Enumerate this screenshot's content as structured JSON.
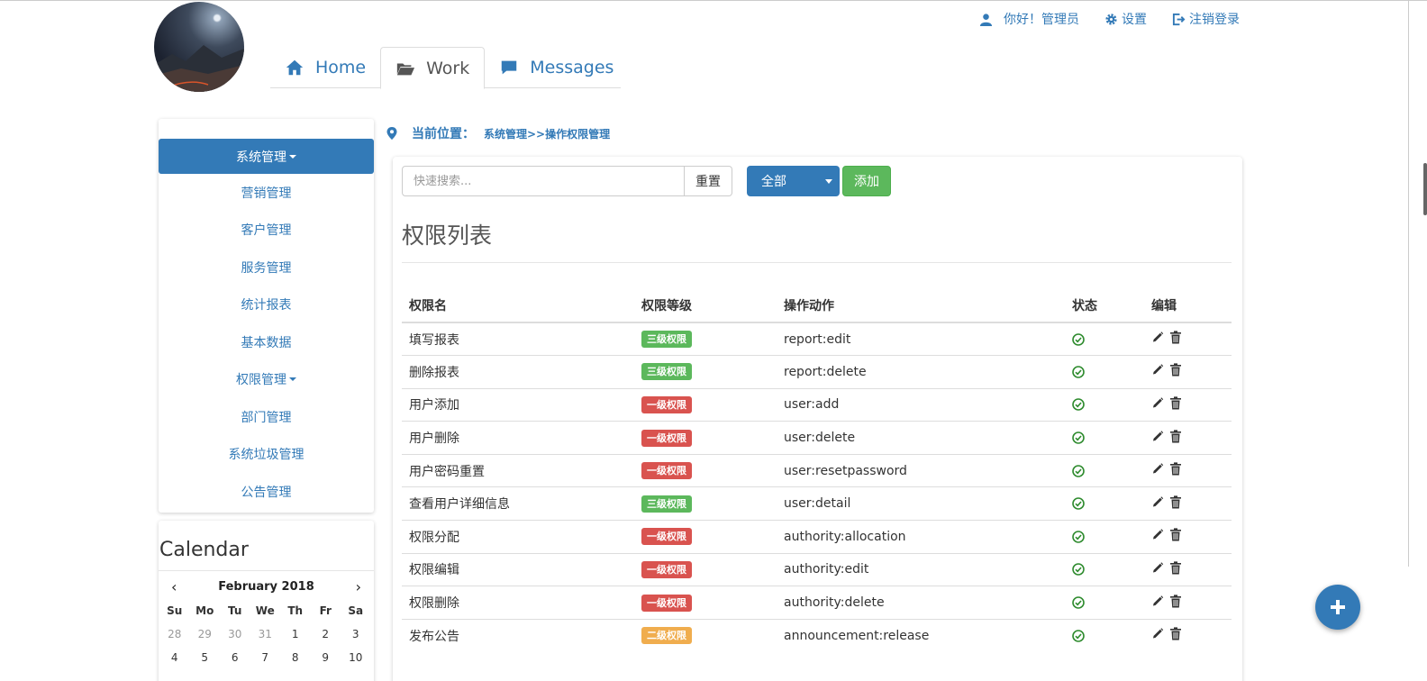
{
  "header": {
    "tabs": [
      {
        "label": "Home",
        "icon": "home-icon"
      },
      {
        "label": "Work",
        "icon": "folder-open-icon"
      },
      {
        "label": "Messages",
        "icon": "comment-icon"
      }
    ],
    "user": {
      "greeting": "你好！管理员",
      "settings": "设置",
      "logout": "注销登录"
    }
  },
  "sidebar": {
    "items": [
      {
        "label": "系统管理"
      },
      {
        "label": "营销管理"
      },
      {
        "label": "客户管理"
      },
      {
        "label": "服务管理"
      },
      {
        "label": "统计报表"
      },
      {
        "label": "基本数据"
      },
      {
        "label": "权限管理"
      },
      {
        "label": "部门管理"
      },
      {
        "label": "系统垃圾管理"
      },
      {
        "label": "公告管理"
      }
    ]
  },
  "calendar": {
    "title": "Calendar",
    "month": "February 2018",
    "prev": "‹",
    "next": "›",
    "dow": [
      "Su",
      "Mo",
      "Tu",
      "We",
      "Th",
      "Fr",
      "Sa"
    ],
    "days": [
      "28",
      "29",
      "30",
      "31",
      "1",
      "2",
      "3",
      "4",
      "5",
      "6",
      "7",
      "8",
      "9",
      "10"
    ]
  },
  "breadcrumb": {
    "label": "当前位置：",
    "path": "系统管理>>操作权限管理"
  },
  "toolbar": {
    "search_placeholder": "快速搜索...",
    "reset": "重置",
    "filter_value": "全部",
    "add": "添加"
  },
  "main": {
    "title": "权限列表",
    "columns": [
      "权限名",
      "权限等级",
      "操作动作",
      "状态",
      "编辑"
    ],
    "rows": [
      {
        "name": "填写报表",
        "level": "三级权限",
        "level_color": "#5cb85c",
        "action": "report:edit"
      },
      {
        "name": "删除报表",
        "level": "三级权限",
        "level_color": "#5cb85c",
        "action": "report:delete"
      },
      {
        "name": "用户添加",
        "level": "一级权限",
        "level_color": "#d9534f",
        "action": "user:add"
      },
      {
        "name": "用户删除",
        "level": "一级权限",
        "level_color": "#d9534f",
        "action": "user:delete"
      },
      {
        "name": "用户密码重置",
        "level": "一级权限",
        "level_color": "#d9534f",
        "action": "user:resetpassword"
      },
      {
        "name": "查看用户详细信息",
        "level": "三级权限",
        "level_color": "#5cb85c",
        "action": "user:detail"
      },
      {
        "name": "权限分配",
        "level": "一级权限",
        "level_color": "#d9534f",
        "action": "authority:allocation"
      },
      {
        "name": "权限编辑",
        "level": "一级权限",
        "level_color": "#d9534f",
        "action": "authority:edit"
      },
      {
        "name": "权限删除",
        "level": "一级权限",
        "level_color": "#d9534f",
        "action": "authority:delete"
      },
      {
        "name": "发布公告",
        "level": "二级权限",
        "level_color": "#f0ad4e",
        "action": "announcement:release"
      }
    ]
  },
  "colors": {
    "primary": "#337ab7",
    "success": "#5cb85c",
    "danger": "#d9534f",
    "warning": "#f0ad4e"
  }
}
